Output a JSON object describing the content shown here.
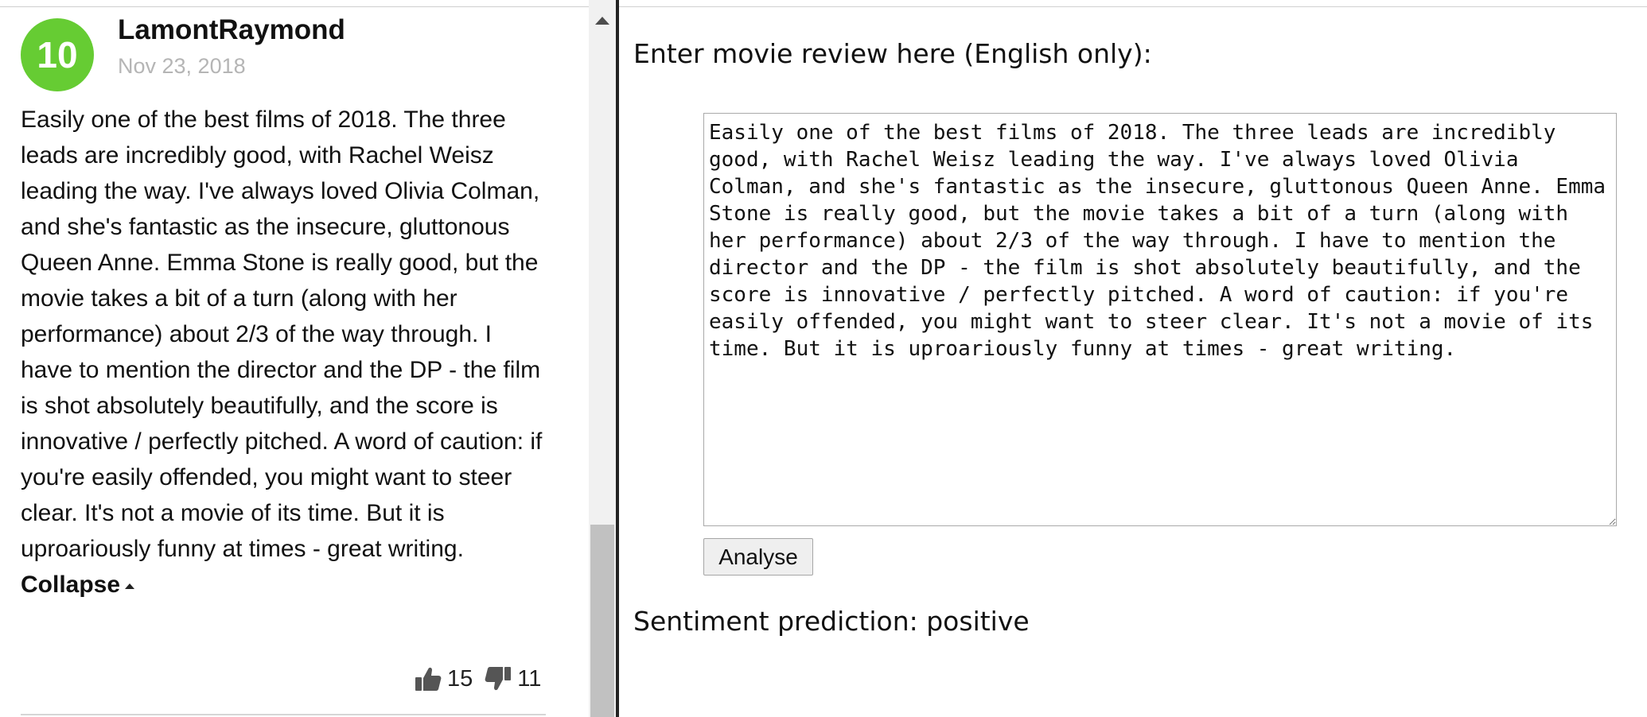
{
  "review": {
    "score": "10",
    "author": "LamontRaymond",
    "date": "Nov 23, 2018",
    "body": "Easily one of the best films of 2018. The three leads are incredibly good, with Rachel Weisz leading the way. I've always loved Olivia Colman, and she's fantastic as the insecure, gluttonous Queen Anne. Emma Stone is really good, but the movie takes a bit of a turn (along with her performance) about 2/3 of the way through. I have to mention the director and the DP - the film is shot absolutely beautifully, and the score is innovative / perfectly pitched. A word of caution: if you're easily offended, you might want to steer clear. It's not a movie of its time. But it is uproariously funny at times - great writing.",
    "collapse_label": "Collapse",
    "upvotes": "15",
    "downvotes": "11",
    "score_color": "#66cc33",
    "icons": {
      "thumbs_up": "thumbs-up-icon",
      "thumbs_down": "thumbs-down-icon",
      "collapse_caret": "caret-up-icon"
    }
  },
  "form": {
    "heading": "Enter movie review here (English only):",
    "textarea_value": "Easily one of the best films of 2018. The three leads are incredibly good, with Rachel Weisz leading the way. I've always loved Olivia Colman, and she's fantastic as the insecure, gluttonous Queen Anne. Emma Stone is really good, but the movie takes a bit of a turn (along with her performance) about 2/3 of the way through. I have to mention the director and the DP - the film is shot absolutely beautifully, and the score is innovative / perfectly pitched. A word of caution: if you're easily offended, you might want to steer clear. It's not a movie of its time. But it is uproariously funny at times - great writing.",
    "analyse_label": "Analyse",
    "prediction": "Sentiment prediction: positive"
  }
}
